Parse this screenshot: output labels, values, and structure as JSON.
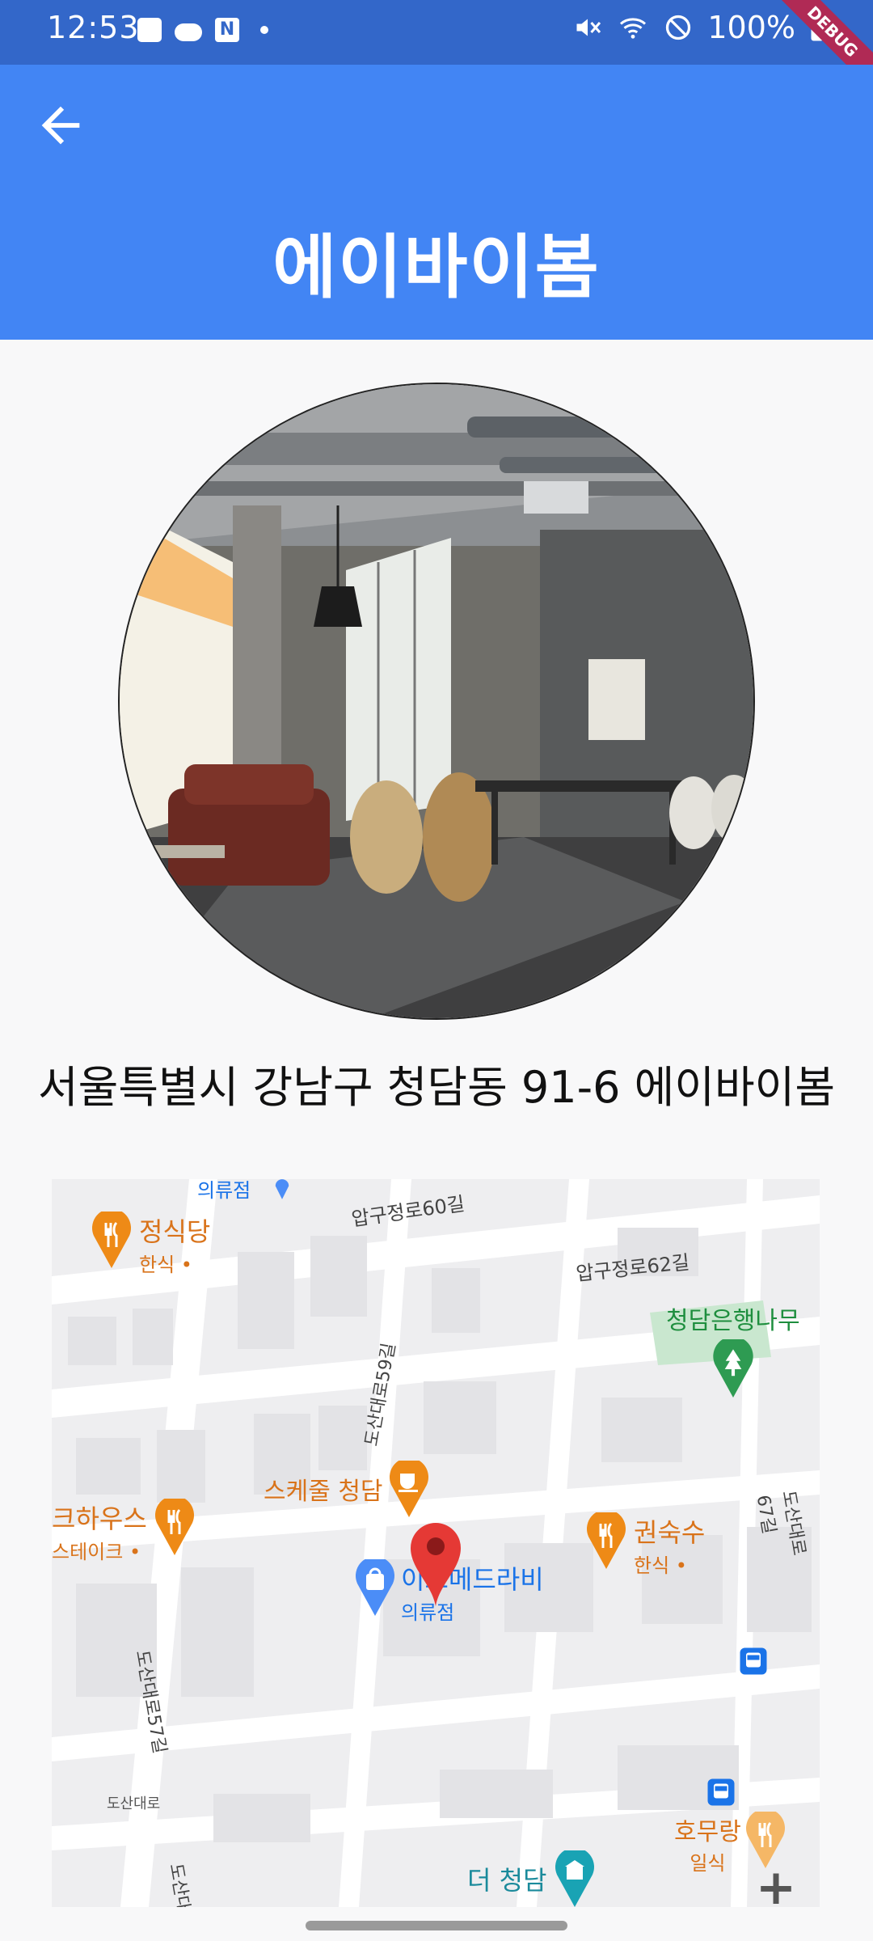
{
  "status_bar": {
    "time": "12:53",
    "left_icons": [
      "gallery-icon",
      "cloud-icon",
      "naver-icon",
      "dot-icon"
    ],
    "right_icons": [
      "mute-icon",
      "wifi-icon",
      "blocked-icon",
      "battery-icon"
    ],
    "battery": "100%"
  },
  "debug_banner": "DEBUG",
  "app_bar": {
    "back_icon": "arrow-back-icon",
    "title": "에이바이봄",
    "color": "#4285f4"
  },
  "place": {
    "address": "서울특별시 강남구 청담동 91-6 에이바이봄"
  },
  "map": {
    "places": [
      {
        "name": "정식당",
        "category": "한식 •",
        "icon": "restaurant-icon",
        "color": "#e8891c"
      },
      {
        "name": "청담은행나무",
        "icon": "park-icon",
        "color": "#1e8e3e"
      },
      {
        "name": "스케줄 청담",
        "icon": "cafe-icon",
        "color": "#e8891c"
      },
      {
        "name": "크하우스",
        "category": "스테이크 •",
        "icon": "restaurant-icon",
        "color": "#e8891c"
      },
      {
        "name": "권숙수",
        "category": "한식 •",
        "icon": "restaurant-icon",
        "color": "#e8891c"
      },
      {
        "name": "이고메드라비",
        "category": "의류점",
        "icon": "shopping-icon",
        "color": "#1a73e8"
      },
      {
        "name": "의류점",
        "icon": "shopping-icon",
        "color": "#1a73e8"
      },
      {
        "name": "호무랑",
        "category": "일식",
        "icon": "restaurant-icon",
        "color": "#e8891c"
      },
      {
        "name": "더 청담",
        "icon": "attraction-icon",
        "color": "#1a9bb0"
      }
    ],
    "streets": [
      "압구정로60길",
      "압구정로62길",
      "도산대로59길",
      "도산대로67길",
      "도산대로57길",
      "도산대로",
      "도산대"
    ],
    "marker_icon": "map-pin-icon",
    "zoom_in_label": "+"
  }
}
